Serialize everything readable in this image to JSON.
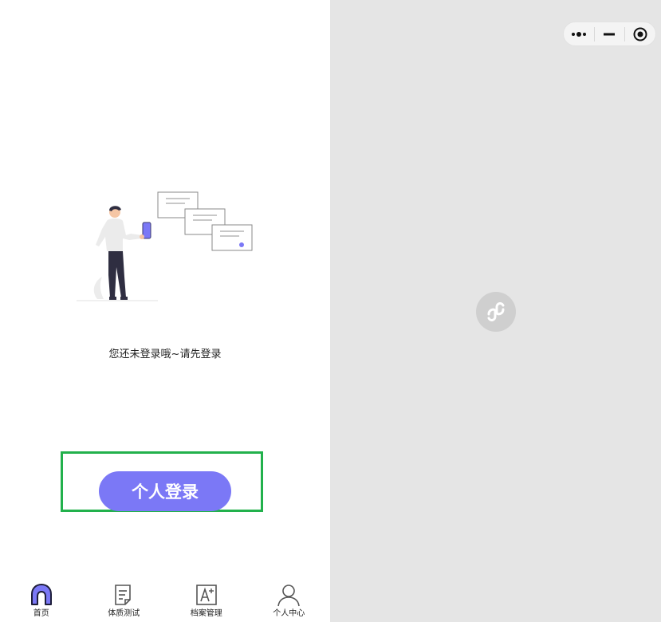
{
  "status": {
    "message": "您还未登录哦~请先登录"
  },
  "login_button": {
    "label": "个人登录"
  },
  "tabbar": {
    "items": [
      {
        "label": "首页",
        "icon": "home-icon",
        "active": true
      },
      {
        "label": "体质测试",
        "icon": "document-icon",
        "active": false
      },
      {
        "label": "档案管理",
        "icon": "font-file-icon",
        "active": false
      },
      {
        "label": "个人中心",
        "icon": "user-icon",
        "active": false
      }
    ]
  },
  "colors": {
    "accent": "#7b78f6",
    "highlight_border": "#22b14c",
    "right_background": "#e5e5e5"
  }
}
